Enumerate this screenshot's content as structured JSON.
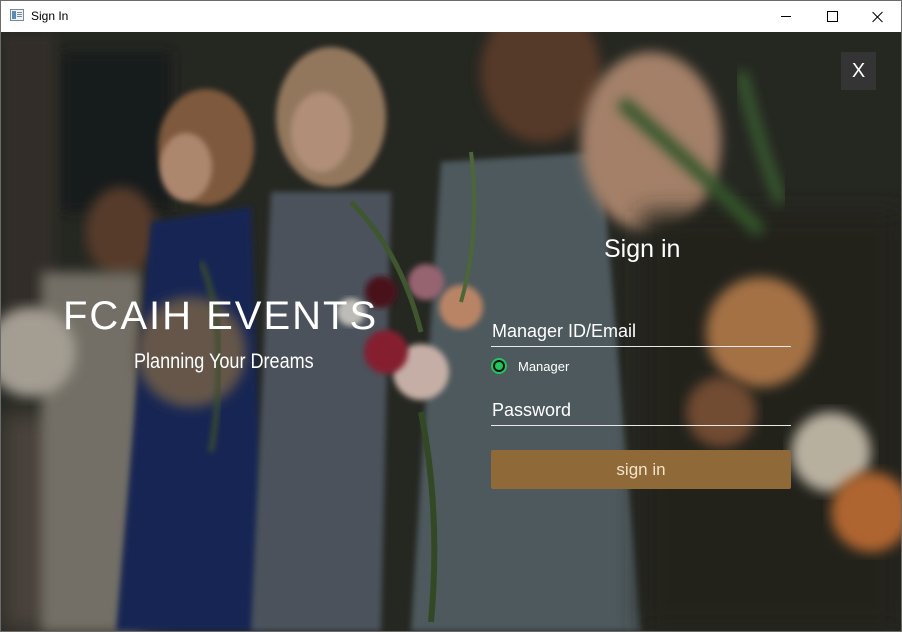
{
  "window": {
    "title": "Sign In",
    "controls": {
      "minimize": "minimize",
      "maximize": "maximize",
      "close": "close"
    }
  },
  "dialog": {
    "close_label": "X",
    "brand": "FCAIH EVENTS",
    "tagline": "Planning Your Dreams",
    "heading": "Sign in",
    "email_placeholder": "Manager ID/Email",
    "role_option": "Manager",
    "password_placeholder": "Password",
    "submit_label": "sign in"
  },
  "icons": [
    "app-icon",
    "minimize-icon",
    "maximize-icon",
    "close-icon",
    "radio-selected-icon"
  ],
  "colors": {
    "button": "#8f6a38",
    "radio_accent": "#22c55e",
    "text": "#ffffff"
  }
}
